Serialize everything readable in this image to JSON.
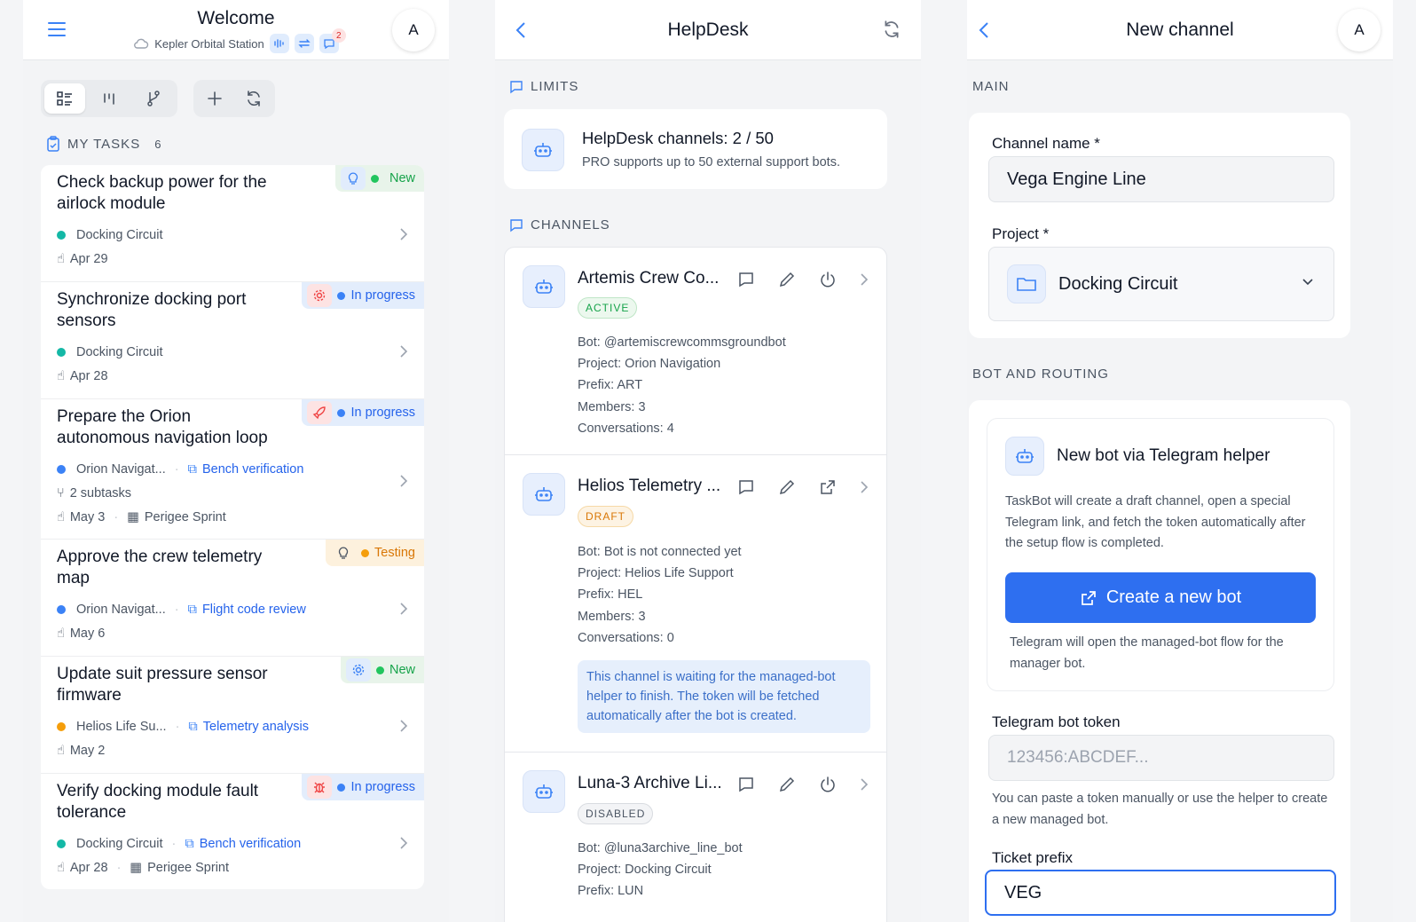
{
  "screen1": {
    "title": "Welcome",
    "workspace": "Kepler Orbital Station",
    "chat_count": "2",
    "avatar": "A",
    "section_title": "MY TASKS",
    "task_count": "6",
    "tasks": [
      {
        "title": "Check backup power for the airlock module",
        "status": "New",
        "status_color": "#16a34a",
        "badge_icon": "lightbulb-icon",
        "project": "Docking Circuit",
        "project_color": "#14b8a6",
        "date": "Apr 29"
      },
      {
        "title": "Synchronize docking port sensors",
        "status": "In progress",
        "status_color": "#2563eb",
        "badge_icon": "gear-icon",
        "project": "Docking Circuit",
        "project_color": "#14b8a6",
        "date": "Apr 28"
      },
      {
        "title": "Prepare the Orion autonomous navigation loop",
        "status": "In progress",
        "status_color": "#2563eb",
        "badge_icon": "rocket-icon",
        "project": "Orion Navigat...",
        "project_color": "#3b82f6",
        "workflow": "Bench verification",
        "subtasks": "2 subtasks",
        "date": "May 3",
        "sprint": "Perigee Sprint"
      },
      {
        "title": "Approve the crew telemetry map",
        "status": "Testing",
        "status_color": "#f59e0b",
        "badge_icon": "lightbulb-icon",
        "project": "Orion Navigat...",
        "project_color": "#3b82f6",
        "workflow": "Flight code review",
        "date": "May 6"
      },
      {
        "title": "Update suit pressure sensor firmware",
        "status": "New",
        "status_color": "#16a34a",
        "badge_icon": "gear-icon",
        "project": "Helios Life Su...",
        "project_color": "#f59e0b",
        "workflow": "Telemetry analysis",
        "date": "May 2"
      },
      {
        "title": "Verify docking module fault tolerance",
        "status": "In progress",
        "status_color": "#2563eb",
        "badge_icon": "bug-icon",
        "project": "Docking Circuit",
        "project_color": "#14b8a6",
        "workflow": "Bench verification",
        "date": "Apr 28",
        "sprint": "Perigee Sprint"
      }
    ]
  },
  "screen2": {
    "title": "HelpDesk",
    "limits_title": "LIMITS",
    "limits_heading": "HelpDesk channels: 2 / 50",
    "limits_sub": "PRO supports up to 50 external support bots.",
    "channels_title": "CHANNELS",
    "channels": [
      {
        "name": "Artemis Crew Co...",
        "status": "ACTIVE",
        "bot": "Bot: @artemiscrewcommsgroundbot",
        "project": "Project: Orion Navigation",
        "prefix": "Prefix: ART",
        "members": "Members: 3",
        "conversations": "Conversations: 4"
      },
      {
        "name": "Helios Telemetry ...",
        "status": "DRAFT",
        "bot": "Bot: Bot is not connected yet",
        "project": "Project: Helios Life Support",
        "prefix": "Prefix: HEL",
        "members": "Members: 3",
        "conversations": "Conversations: 0",
        "note": "This channel is waiting for the managed-bot helper to finish. The token will be fetched automatically after the bot is created."
      },
      {
        "name": "Luna-3 Archive Li...",
        "status": "DISABLED",
        "bot": "Bot: @luna3archive_line_bot",
        "project": "Project: Docking Circuit",
        "prefix": "Prefix: LUN"
      }
    ]
  },
  "screen3": {
    "title": "New channel",
    "avatar": "A",
    "main_title": "MAIN",
    "channel_name_label": "Channel name *",
    "channel_name_value": "Vega Engine Line",
    "project_label": "Project *",
    "project_value": "Docking Circuit",
    "routing_title": "BOT AND ROUTING",
    "helper_title": "New bot via Telegram helper",
    "helper_desc": "TaskBot will create a draft channel, open a special Telegram link, and fetch the token automatically after the setup flow is completed.",
    "create_button": "Create a new bot",
    "create_hint": "Telegram will open the managed-bot flow for the manager bot.",
    "token_label": "Telegram bot token",
    "token_placeholder": "123456:ABCDEF...",
    "token_help": "You can paste a token manually or use the helper to create a new managed bot.",
    "prefix_label": "Ticket prefix",
    "prefix_value": "VEG"
  }
}
